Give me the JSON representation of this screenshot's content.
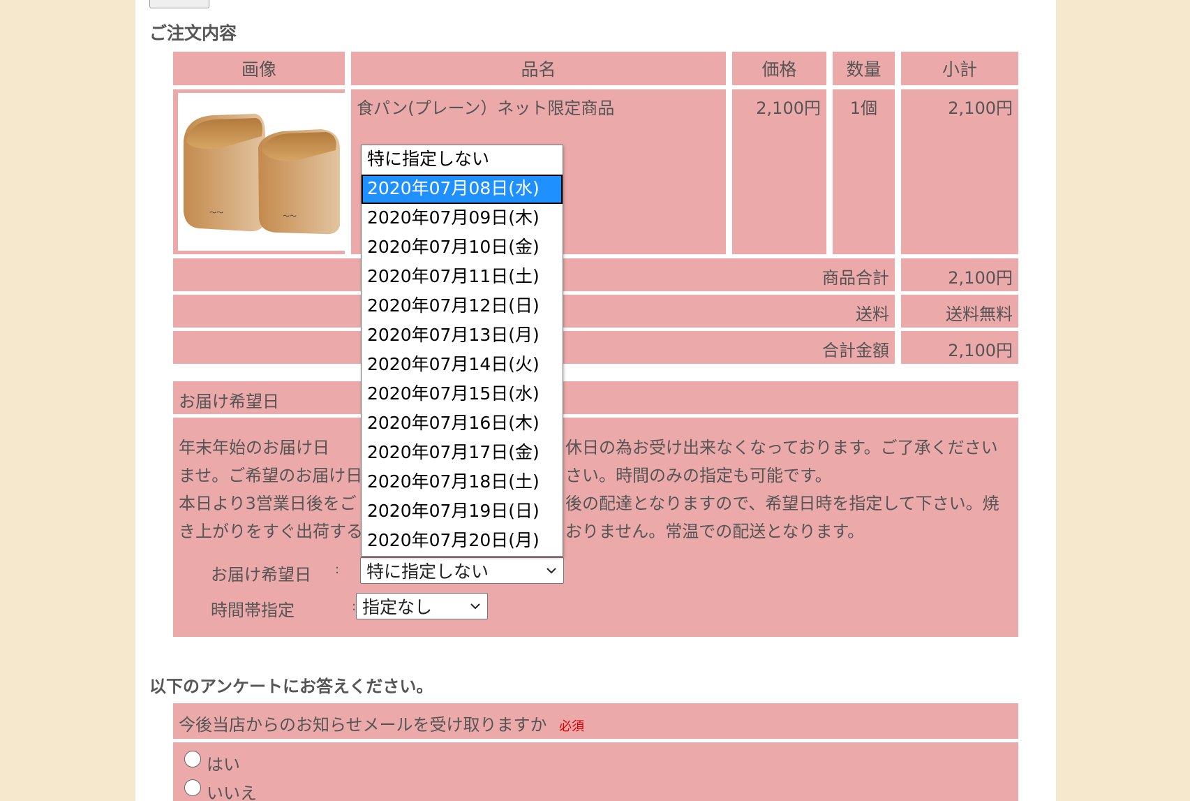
{
  "order": {
    "title": "ご注文内容",
    "headers": {
      "image": "画像",
      "name": "品名",
      "price": "価格",
      "qty": "数量",
      "subtotal": "小計"
    },
    "item": {
      "name": "食パン(プレーン）ネット限定商品",
      "price": "2,100円",
      "qty": "1個",
      "subtotal": "2,100円",
      "image_icon": "bread-loaf-image"
    },
    "totals": [
      {
        "label": "商品合計",
        "value": "2,100円"
      },
      {
        "label": "送料",
        "value": "送料無料"
      },
      {
        "label": "合計金額",
        "value": "2,100円"
      }
    ]
  },
  "delivery": {
    "title": "お届け希望日",
    "notice_lines": [
      "年末年始のお届け日",
      "休日の為お受け出来なくなっております。ご了承ください",
      "ませ。ご希望のお届け日",
      "さい。時間のみの指定も可能です。",
      "本日より3営業日後をご",
      "後の配達となりますので、希望日時を指定して下さい。焼",
      "き上がりをすぐ出荷する",
      "おりません。常温での配送となります。"
    ],
    "date_label": "お届け希望日",
    "date_colon": ":",
    "date_selected": "特に指定しない",
    "time_label": "時間帯指定",
    "time_colon": ":",
    "time_selected": "指定なし",
    "date_options": [
      "特に指定しない",
      "2020年07月08日(水)",
      "2020年07月09日(木)",
      "2020年07月10日(金)",
      "2020年07月11日(土)",
      "2020年07月12日(日)",
      "2020年07月13日(月)",
      "2020年07月14日(火)",
      "2020年07月15日(水)",
      "2020年07月16日(木)",
      "2020年07月17日(金)",
      "2020年07月18日(土)",
      "2020年07月19日(日)",
      "2020年07月20日(月)"
    ],
    "highlighted_index": 1
  },
  "survey": {
    "title": "以下のアンケートにお答えください。",
    "question": "今後当店からのお知らせメールを受け取りますか",
    "required": "必須",
    "options": [
      "はい",
      "いいえ"
    ]
  },
  "colors": {
    "page_bg": "#f6e8cd",
    "cell_bg": "#eca9a9",
    "highlight": "#1e90ff",
    "required": "#e00000"
  }
}
